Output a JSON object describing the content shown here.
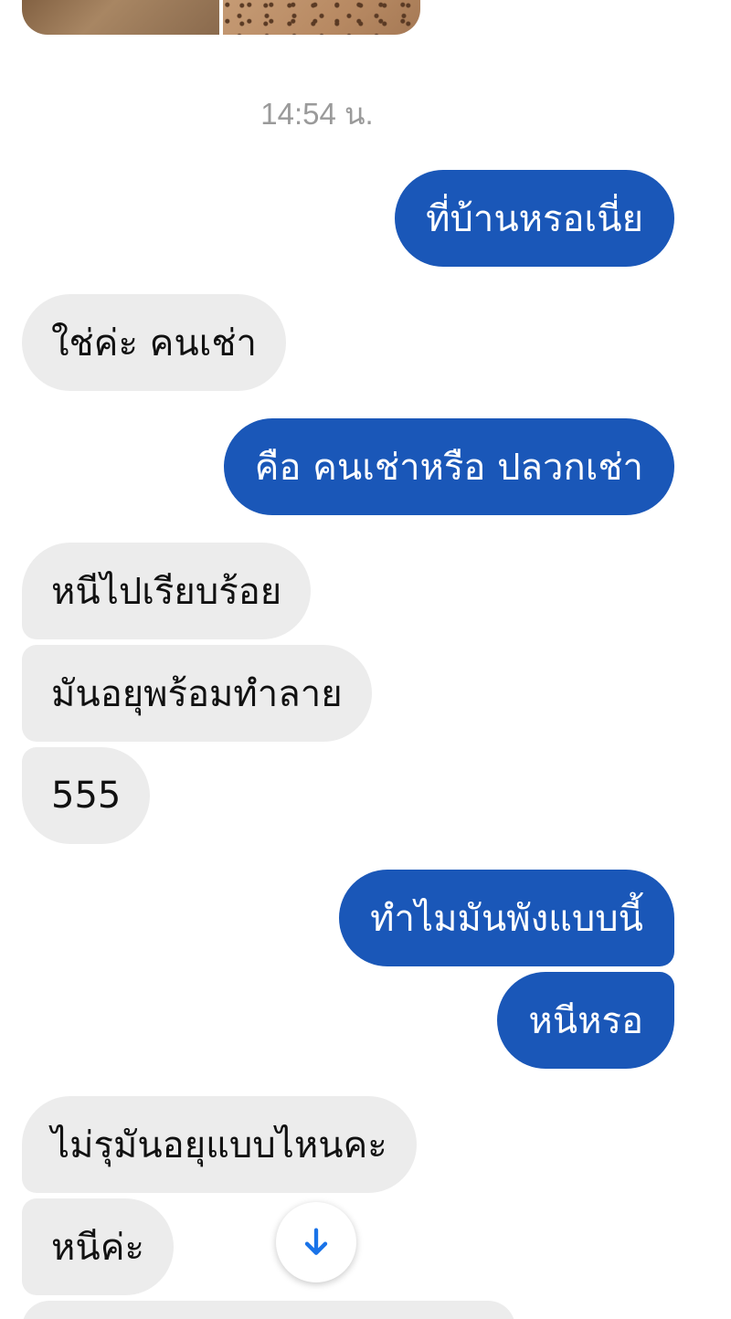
{
  "chat": {
    "timestamp": "14:54 น.",
    "messages": [
      {
        "side": "out",
        "text": "ที่บ้านหรอเนี่ย"
      },
      {
        "side": "in",
        "text": "ใช่ค่ะ คนเช่า"
      },
      {
        "side": "out",
        "text": "คือ คนเช่าหรือ ปลวกเช่า"
      },
      {
        "side": "in",
        "text": "หนีไปเรียบร้อย"
      },
      {
        "side": "in",
        "text": "มันอยุพร้อมทำลาย"
      },
      {
        "side": "in",
        "text": "555"
      },
      {
        "side": "out",
        "text": "ทำไมมันพังแบบนี้"
      },
      {
        "side": "out",
        "text": "หนีหรอ"
      },
      {
        "side": "in",
        "text": "ไม่รุมันอยุแบบไหนคะ"
      },
      {
        "side": "in",
        "text": "หนีค่ะ"
      }
    ]
  },
  "scroll_button": {
    "icon": "arrow-down-icon"
  },
  "colors": {
    "outgoing_bubble": "#1a57b8",
    "incoming_bubble": "#ececec",
    "timestamp": "#9a9a9a",
    "scroll_arrow": "#1a73e8"
  }
}
